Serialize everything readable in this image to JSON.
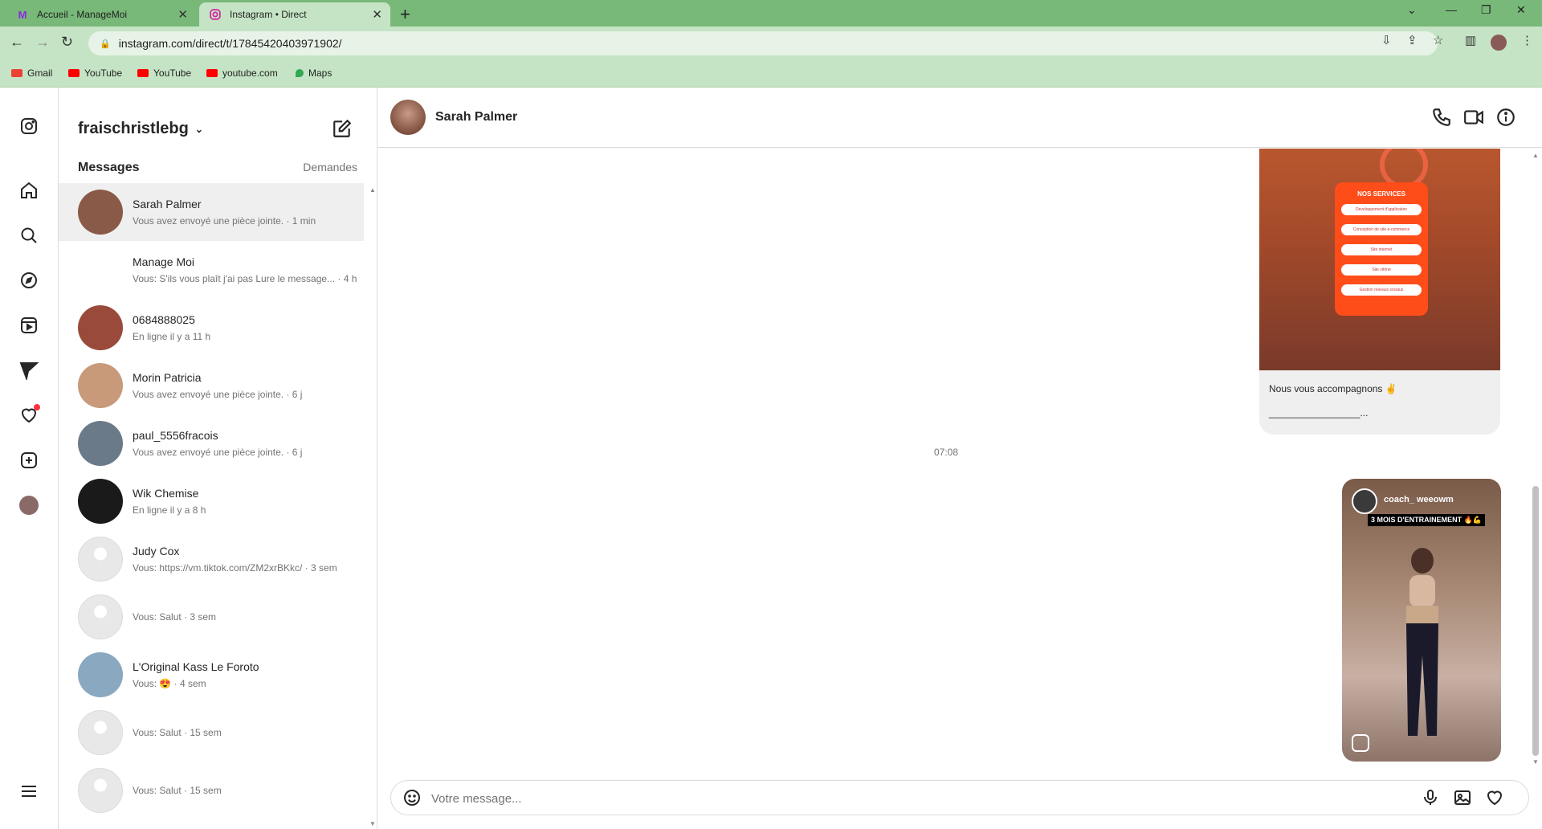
{
  "browser": {
    "tabs": [
      {
        "title": "Accueil - ManageMoi"
      },
      {
        "title": "Instagram • Direct"
      }
    ],
    "url": "instagram.com/direct/t/17845420403971902/",
    "bookmarks": [
      {
        "label": "Gmail"
      },
      {
        "label": "YouTube"
      },
      {
        "label": "YouTube"
      },
      {
        "label": "youtube.com"
      },
      {
        "label": "Maps"
      }
    ]
  },
  "sidebar": {
    "username": "fraischristlebg",
    "messages_heading": "Messages",
    "requests_label": "Demandes"
  },
  "conversations": [
    {
      "name": "Sarah Palmer",
      "sub": "Vous avez envoyé une pièce jointe. · 1 min",
      "color": "#8a5a48"
    },
    {
      "name": "Manage Moi",
      "sub": "Vous: S'ils vous plaît j'ai pas Lure le message... · 4 h",
      "color": "#ffffff"
    },
    {
      "name": "0684888025",
      "sub": "En ligne il y a 11 h",
      "color": "#9a4a3a"
    },
    {
      "name": "Morin Patricia",
      "sub": "Vous avez envoyé une pièce jointe. · 6 j",
      "color": "#c89a7a"
    },
    {
      "name": "paul_5556fracois",
      "sub": "Vous avez envoyé une pièce jointe. · 6 j",
      "color": "#6a7a88"
    },
    {
      "name": "Wik Chemise",
      "sub": "En ligne il y a 8 h",
      "color": "#1a1a1a"
    },
    {
      "name": "Judy Cox",
      "sub": "Vous: https://vm.tiktok.com/ZM2xrBKkc/ · 3 sem",
      "color": "#e8e8e8"
    },
    {
      "name": "",
      "sub": "Vous: Salut · 3 sem",
      "color": "#e8e8e8"
    },
    {
      "name": "L'Original Kass Le Foroto",
      "sub": "Vous: 😍 · 4 sem",
      "color": "#8aa8c0"
    },
    {
      "name": "",
      "sub": "Vous: Salut · 15 sem",
      "color": "#e8e8e8"
    },
    {
      "name": "",
      "sub": "Vous: Salut · 15 sem",
      "color": "#e8e8e8"
    }
  ],
  "chat": {
    "contact_name": "Sarah Palmer",
    "post": {
      "card_title": "NOS SERVICES",
      "services": [
        "Developpement d'application",
        "Conception de site e-commerce",
        "Site internet",
        "Site vitrine",
        "Gestion réseaux sociaux"
      ],
      "caption_line1": "Nous vous accompagnons ✌",
      "caption_line2": "_________________..."
    },
    "timestamp": "07:08",
    "reel": {
      "author": "coach_ weeowm",
      "overlay_text": "3 MOIS D'ENTRAINEMENT 🔥💪"
    },
    "composer_placeholder": "Votre message..."
  }
}
